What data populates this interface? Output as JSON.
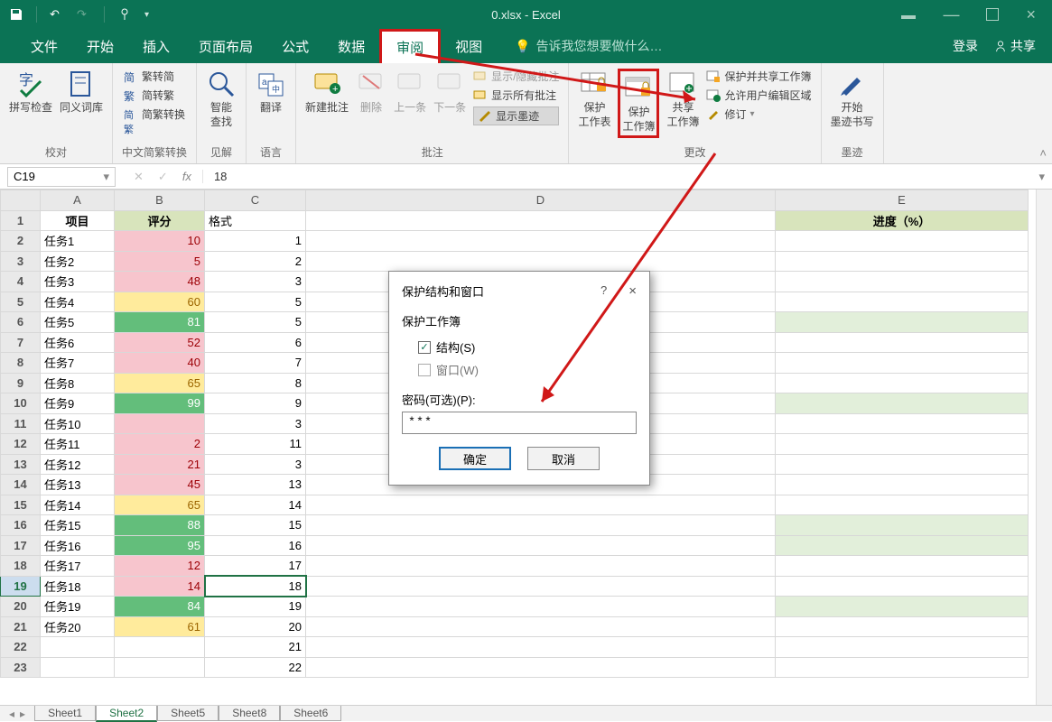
{
  "app": {
    "title": "0.xlsx - Excel"
  },
  "tabs": {
    "file": "文件",
    "home": "开始",
    "insert": "插入",
    "layout": "页面布局",
    "formula": "公式",
    "data": "数据",
    "review": "审阅",
    "view": "视图",
    "tellme": "告诉我您想要做什么…",
    "login": "登录",
    "share": "共享"
  },
  "ribbon": {
    "proof": {
      "spell": "拼写检查",
      "thes": "同义词库",
      "label": "校对"
    },
    "chs": {
      "s2t": "繁转简",
      "t2s": "简转繁",
      "conv": "简繁转换",
      "label": "中文简繁转换"
    },
    "insight": {
      "smart": "智能\n查找",
      "label": "见解"
    },
    "lang": {
      "trans": "翻译",
      "label": "语言"
    },
    "comments": {
      "new": "新建批注",
      "del": "删除",
      "prev": "上一条",
      "next": "下一条",
      "showhide": "显示/隐藏批注",
      "showall": "显示所有批注",
      "ink": "显示墨迹",
      "label": "批注"
    },
    "changes": {
      "psheet": "保护\n工作表",
      "pbook": "保护\n工作簿",
      "sbook": "共享\n工作簿",
      "pshare": "保护并共享工作簿",
      "allow": "允许用户编辑区域",
      "track": "修订",
      "label": "更改"
    },
    "ink2": {
      "start": "开始\n墨迹书写",
      "label": "墨迹"
    }
  },
  "namebox": {
    "ref": "C19",
    "fx": "18"
  },
  "headers": {
    "A": "项目",
    "B": "评分",
    "C": "格式",
    "E": "进度（%）"
  },
  "cols": [
    "A",
    "B",
    "C",
    "D",
    "E"
  ],
  "rows": [
    {
      "n": 1
    },
    {
      "n": 2,
      "a": "任务1",
      "b": 10,
      "c": 1,
      "bcls": "pink"
    },
    {
      "n": 3,
      "a": "任务2",
      "b": 5,
      "c": 2,
      "bcls": "pink"
    },
    {
      "n": 4,
      "a": "任务3",
      "b": 48,
      "c": 3,
      "bcls": "pink"
    },
    {
      "n": 5,
      "a": "任务4",
      "b": 60,
      "c": 5,
      "bcls": "yellow"
    },
    {
      "n": 6,
      "a": "任务5",
      "b": 81,
      "c": 5,
      "bcls": "green2",
      "ecls": "ltgreen"
    },
    {
      "n": 7,
      "a": "任务6",
      "b": 52,
      "c": 6,
      "bcls": "pink"
    },
    {
      "n": 8,
      "a": "任务7",
      "b": 40,
      "c": 7,
      "bcls": "pink"
    },
    {
      "n": 9,
      "a": "任务8",
      "b": 65,
      "c": 8,
      "bcls": "yellow"
    },
    {
      "n": 10,
      "a": "任务9",
      "b": 99,
      "c": 9,
      "bcls": "green2",
      "ecls": "ltgreen"
    },
    {
      "n": 11,
      "a": "任务10",
      "b": "",
      "c": 3,
      "bcls": "pink"
    },
    {
      "n": 12,
      "a": "任务11",
      "b": 2,
      "c": 11,
      "bcls": "pink"
    },
    {
      "n": 13,
      "a": "任务12",
      "b": 21,
      "c": 3,
      "bcls": "pink"
    },
    {
      "n": 14,
      "a": "任务13",
      "b": 45,
      "c": 13,
      "bcls": "pink"
    },
    {
      "n": 15,
      "a": "任务14",
      "b": 65,
      "c": 14,
      "bcls": "yellow"
    },
    {
      "n": 16,
      "a": "任务15",
      "b": 88,
      "c": 15,
      "bcls": "green2",
      "ecls": "ltgreen"
    },
    {
      "n": 17,
      "a": "任务16",
      "b": 95,
      "c": 16,
      "bcls": "green2",
      "ecls": "ltgreen"
    },
    {
      "n": 18,
      "a": "任务17",
      "b": 12,
      "c": 17,
      "bcls": "pink"
    },
    {
      "n": 19,
      "a": "任务18",
      "b": 14,
      "c": 18,
      "bcls": "pink",
      "sel": true
    },
    {
      "n": 20,
      "a": "任务19",
      "b": 84,
      "c": 19,
      "bcls": "green2",
      "ecls": "ltgreen"
    },
    {
      "n": 21,
      "a": "任务20",
      "b": 61,
      "c": 20,
      "bcls": "yellow"
    },
    {
      "n": 22,
      "a": "",
      "b": "",
      "c": 21
    },
    {
      "n": 23,
      "a": "",
      "b": "",
      "c": 22
    }
  ],
  "dialog": {
    "title": "保护结构和窗口",
    "help": "?",
    "close": "×",
    "section": "保护工作簿",
    "opt_struct": "结构(S)",
    "opt_window": "窗口(W)",
    "pwd_label": "密码(可选)(P):",
    "pwd_value": "***",
    "ok": "确定",
    "cancel": "取消"
  },
  "sheets": [
    "Sheet1",
    "Sheet2",
    "Sheet5",
    "Sheet8",
    "Sheet6"
  ]
}
